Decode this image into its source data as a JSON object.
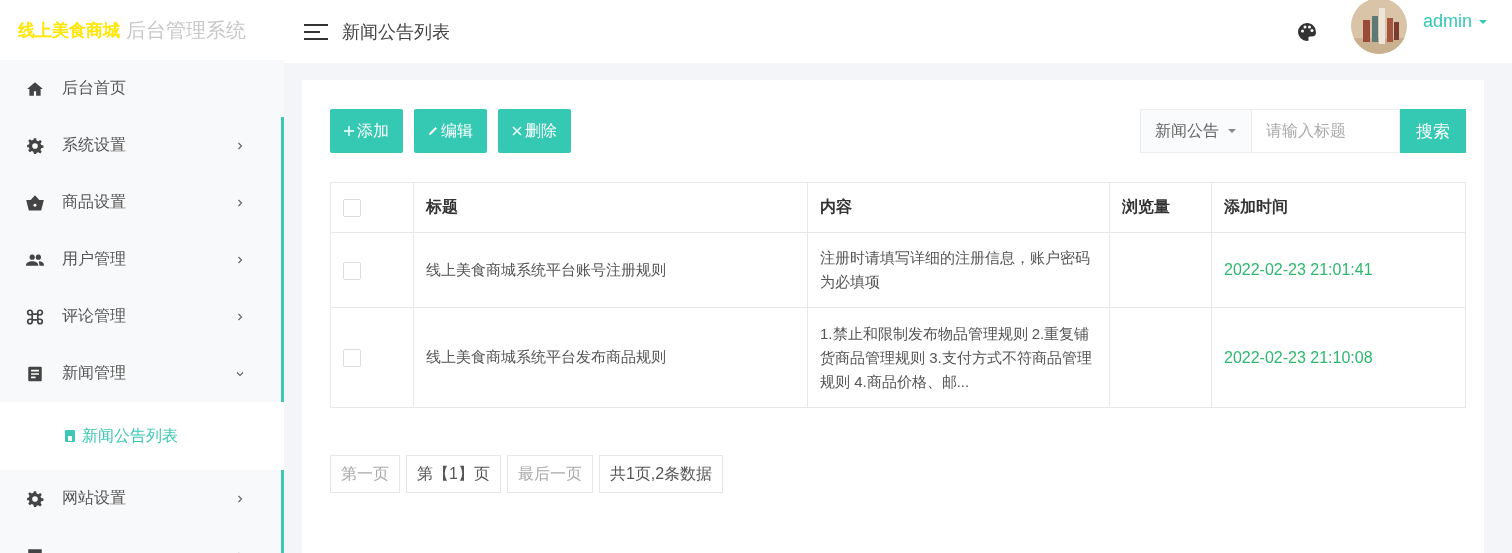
{
  "logo": {
    "brand": "线上美食商城",
    "subtitle": "后台管理系统"
  },
  "header": {
    "title": "新闻公告列表",
    "user": "admin"
  },
  "sidebar": {
    "items": [
      {
        "label": "后台首页"
      },
      {
        "label": "系统设置",
        "expanded": false
      },
      {
        "label": "商品设置",
        "expanded": false
      },
      {
        "label": "用户管理",
        "expanded": false
      },
      {
        "label": "评论管理",
        "expanded": false
      },
      {
        "label": "新闻管理",
        "expanded": true,
        "children": [
          {
            "label": "新闻公告列表",
            "selected": true
          }
        ]
      },
      {
        "label": "网站设置",
        "expanded": false
      },
      {
        "expanded": false
      }
    ]
  },
  "toolbar": {
    "buttons": [
      {
        "label": "添加"
      },
      {
        "label": "编辑"
      },
      {
        "label": "删除"
      }
    ],
    "filter": "新闻公告",
    "search": {
      "placeholder": "请输入标题"
    },
    "search_button": "搜索"
  },
  "table": {
    "select_all": {
      "checked": false
    },
    "columns": [
      "标题",
      "内容",
      "浏览量",
      "添加时间"
    ],
    "rows": [
      {
        "checked": false,
        "title": "线上美食商城系统平台账号注册规则",
        "content": "注册时请填写详细的注册信息，账户密码为必填项",
        "time": "2022-02-23 21:01:41"
      },
      {
        "checked": false,
        "title": "线上美食商城系统平台发布商品规则",
        "content": "1.禁止和限制发布物品管理规则 2.重复铺货商品管理规则 3.支付方式不符商品管理规则 4.商品价格、邮...",
        "time": "2022-02-23 21:10:08"
      }
    ]
  },
  "pagination": [
    {
      "label": "第一页",
      "disabled": true
    },
    {
      "label": "第【1】页",
      "disabled": false
    },
    {
      "label": "最后一页",
      "disabled": true
    },
    {
      "label": "共1页,2条数据",
      "disabled": false
    }
  ]
}
